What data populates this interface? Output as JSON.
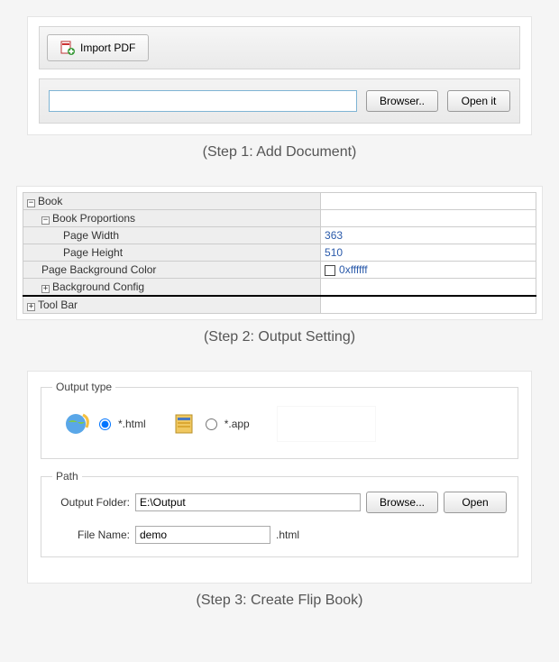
{
  "step1": {
    "import_label": "Import PDF",
    "path_value": "",
    "browser_label": "Browser..",
    "open_label": "Open it",
    "caption": "(Step 1: Add Document)"
  },
  "step2": {
    "rows": {
      "book": "Book",
      "book_proportions": "Book Proportions",
      "page_width_label": "Page Width",
      "page_width_value": "363",
      "page_height_label": "Page Height",
      "page_height_value": "510",
      "bgcolor_label": "Page Background Color",
      "bgcolor_value": "0xffffff",
      "bgconfig": "Background Config",
      "toolbar": "Tool Bar"
    },
    "caption": "(Step 2: Output Setting)"
  },
  "step3": {
    "output_type_legend": "Output type",
    "opt_html_label": "*.html",
    "opt_app_label": "*.app",
    "path_legend": "Path",
    "output_folder_label": "Output Folder:",
    "output_folder_value": "E:\\Output",
    "browse_label": "Browse...",
    "open_label": "Open",
    "filename_label": "File Name:",
    "filename_value": "demo",
    "filename_ext": ".html",
    "caption": "(Step 3: Create Flip Book)"
  }
}
